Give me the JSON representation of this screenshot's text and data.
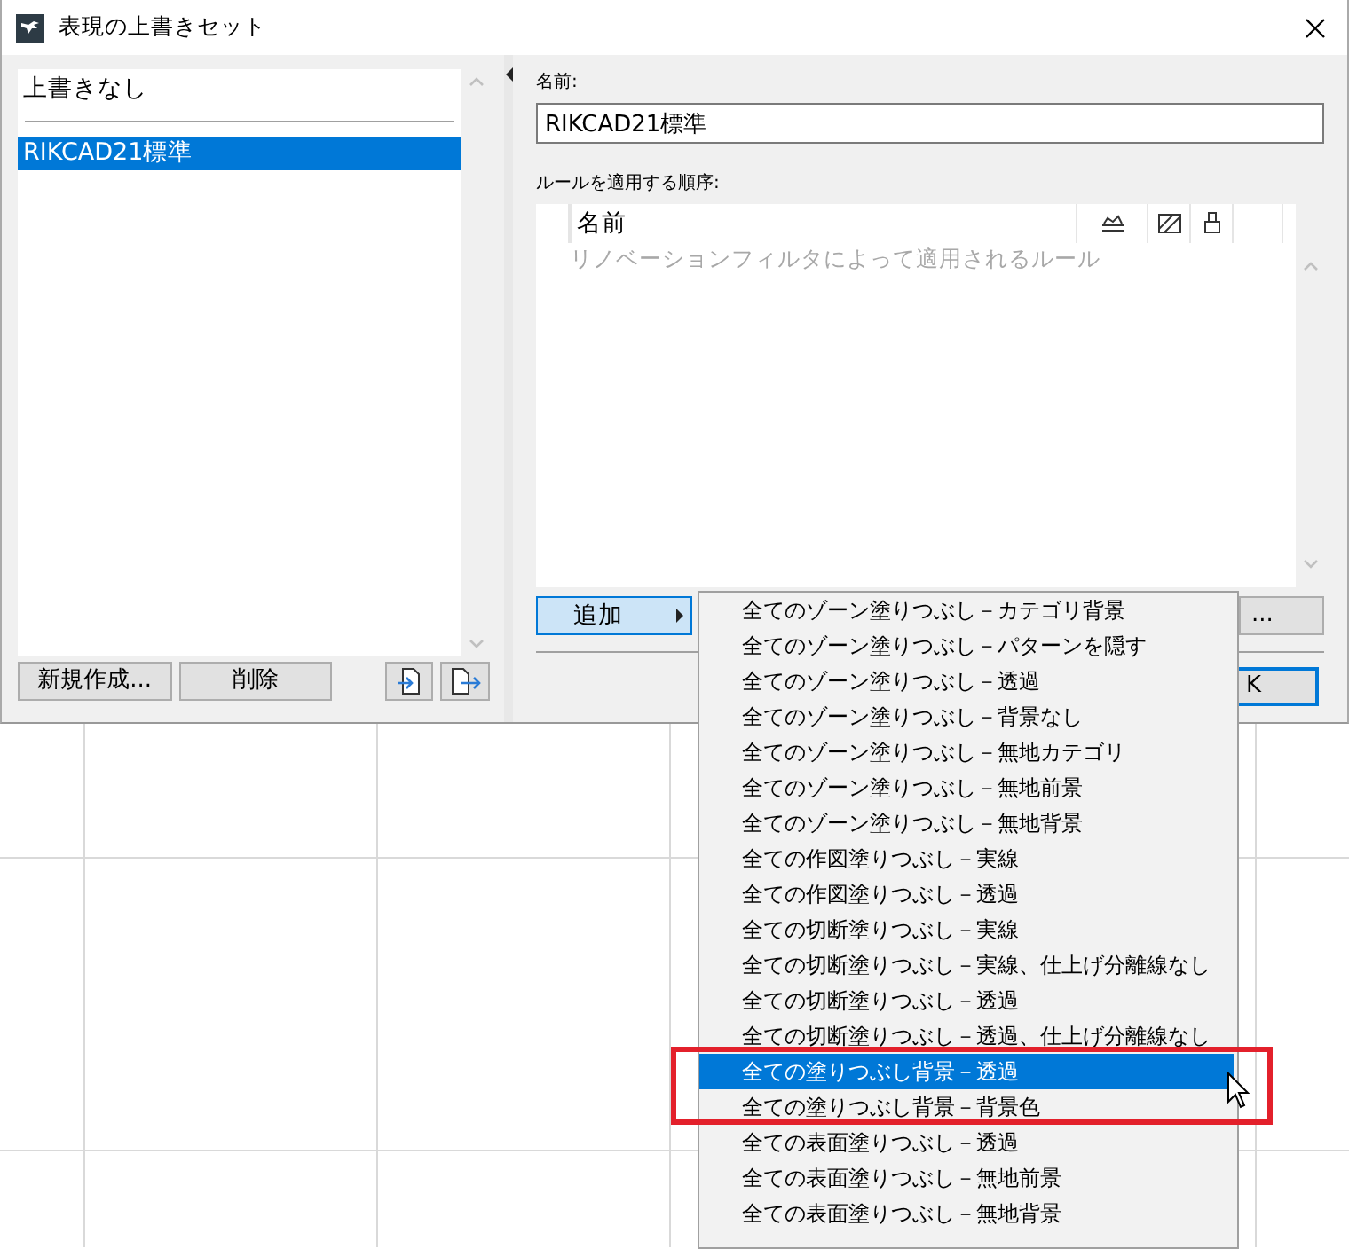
{
  "window": {
    "title": "表現の上書きセット"
  },
  "override_sets": {
    "items": [
      {
        "label": "上書きなし",
        "selected": false,
        "separator_after": true
      },
      {
        "label": "RIKCAD21標準",
        "selected": true,
        "separator_after": false
      }
    ],
    "buttons": [
      "新規作成...",
      "削除"
    ]
  },
  "name_field": {
    "label": "名前:",
    "value": "RIKCAD21標準"
  },
  "rules": {
    "label": "ルールを適用する順序:",
    "columns": [
      "名前"
    ],
    "placeholder_row": "リノベーションフィルタによって適用されるルール"
  },
  "add_button": {
    "label": "追加",
    "active": true
  },
  "partial_button": {
    "label": "..."
  },
  "ok_button": {
    "label": "K",
    "default": true
  },
  "add_menu": {
    "items": [
      {
        "label": "全てのゾーン塗りつぶし－カテゴリ背景",
        "selected": false
      },
      {
        "label": "全てのゾーン塗りつぶし－パターンを隠す",
        "selected": false
      },
      {
        "label": "全てのゾーン塗りつぶし－透過",
        "selected": false
      },
      {
        "label": "全てのゾーン塗りつぶし－背景なし",
        "selected": false
      },
      {
        "label": "全てのゾーン塗りつぶし－無地カテゴリ",
        "selected": false
      },
      {
        "label": "全てのゾーン塗りつぶし－無地前景",
        "selected": false
      },
      {
        "label": "全てのゾーン塗りつぶし－無地背景",
        "selected": false
      },
      {
        "label": "全ての作図塗りつぶし－実線",
        "selected": false
      },
      {
        "label": "全ての作図塗りつぶし－透過",
        "selected": false
      },
      {
        "label": "全ての切断塗りつぶし－実線",
        "selected": false
      },
      {
        "label": "全ての切断塗りつぶし－実線、仕上げ分離線なし",
        "selected": false
      },
      {
        "label": "全ての切断塗りつぶし－透過",
        "selected": false
      },
      {
        "label": "全ての切断塗りつぶし－透過、仕上げ分離線なし",
        "selected": false
      },
      {
        "label": "全ての塗りつぶし背景－透過",
        "selected": true
      },
      {
        "label": "全ての塗りつぶし背景－背景色",
        "selected": false
      },
      {
        "label": "全ての表面塗りつぶし－透過",
        "selected": false
      },
      {
        "label": "全ての表面塗りつぶし－無地前景",
        "selected": false
      },
      {
        "label": "全ての表面塗りつぶし－無地背景",
        "selected": false
      }
    ]
  }
}
